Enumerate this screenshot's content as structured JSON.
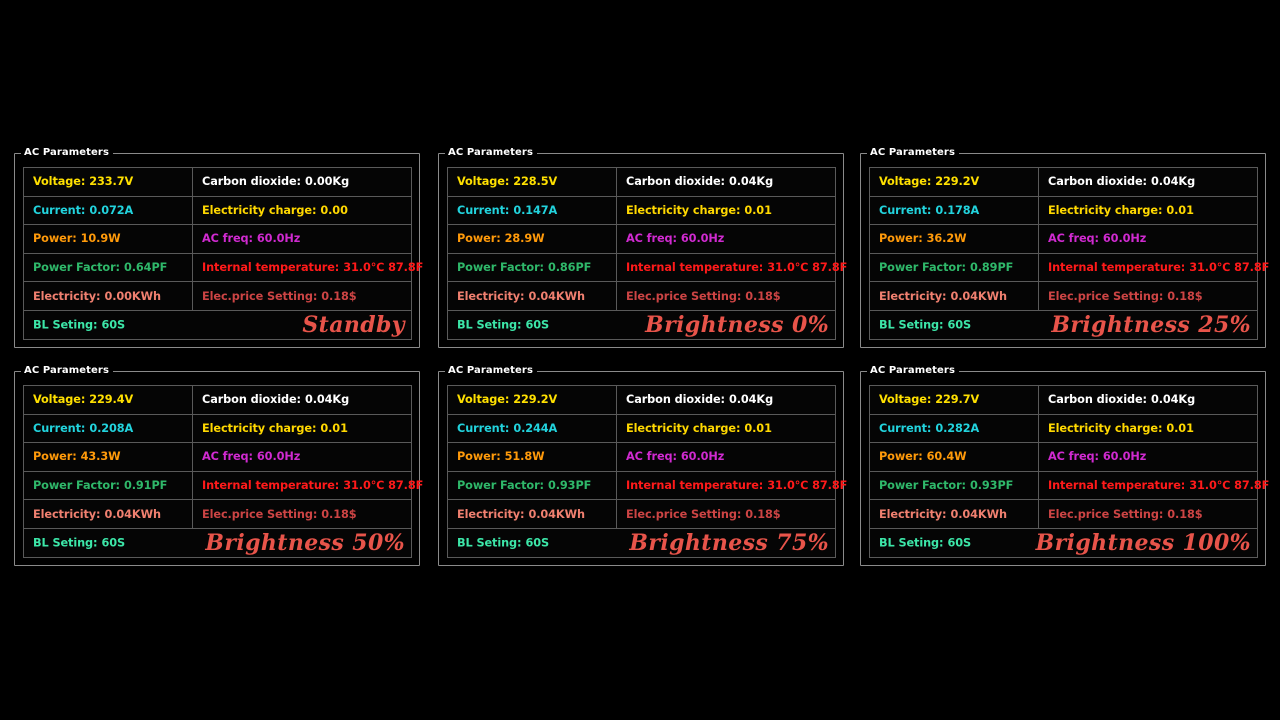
{
  "group_title": "AC Parameters",
  "labels": {
    "voltage": "Voltage:",
    "current": "Current:",
    "power": "Power:",
    "power_factor": "Power Factor:",
    "electricity": "Electricity:",
    "bl_seting": "BL Seting:",
    "carbon_dioxide": "Carbon dioxide:",
    "electricity_charge": "Electricity charge:",
    "ac_freq": "AC freq:",
    "internal_temperature": "Internal temperature:",
    "elec_price_setting": "Elec.price Setting:"
  },
  "colors": {
    "background": "#000000",
    "panel_border": "#8a8a8a",
    "table_border": "#5a5a5a",
    "voltage": "#ffe000",
    "current": "#22d3dd",
    "power": "#ff9a0a",
    "power_factor": "#2fb86a",
    "electricity": "#f08070",
    "bl_seting": "#3ce6a8",
    "carbon_dioxide": "#ffffff",
    "electricity_charge": "#ffd800",
    "ac_freq": "#d02ad0",
    "internal_temperature": "#ff1a1a",
    "elec_price_setting": "#cc4444",
    "status": "#e8544a"
  },
  "panels": [
    {
      "voltage": "233.7V",
      "current": "0.072A",
      "power": "10.9W",
      "power_factor": "0.64PF",
      "electricity": "0.00KWh",
      "bl_seting": "60S",
      "carbon_dioxide": "0.00Kg",
      "electricity_charge": "0.00",
      "ac_freq": "60.0Hz",
      "internal_temperature": "31.0℃ 87.8F",
      "elec_price_setting": "0.18$",
      "status": "Standby"
    },
    {
      "voltage": "228.5V",
      "current": "0.147A",
      "power": "28.9W",
      "power_factor": "0.86PF",
      "electricity": "0.04KWh",
      "bl_seting": "60S",
      "carbon_dioxide": "0.04Kg",
      "electricity_charge": "0.01",
      "ac_freq": "60.0Hz",
      "internal_temperature": "31.0℃ 87.8F",
      "elec_price_setting": "0.18$",
      "status": "Brightness 0%"
    },
    {
      "voltage": "229.2V",
      "current": "0.178A",
      "power": "36.2W",
      "power_factor": "0.89PF",
      "electricity": "0.04KWh",
      "bl_seting": "60S",
      "carbon_dioxide": "0.04Kg",
      "electricity_charge": "0.01",
      "ac_freq": "60.0Hz",
      "internal_temperature": "31.0℃ 87.8F",
      "elec_price_setting": "0.18$",
      "status": "Brightness 25%"
    },
    {
      "voltage": "229.4V",
      "current": "0.208A",
      "power": "43.3W",
      "power_factor": "0.91PF",
      "electricity": "0.04KWh",
      "bl_seting": "60S",
      "carbon_dioxide": "0.04Kg",
      "electricity_charge": "0.01",
      "ac_freq": "60.0Hz",
      "internal_temperature": "31.0℃ 87.8F",
      "elec_price_setting": "0.18$",
      "status": "Brightness 50%"
    },
    {
      "voltage": "229.2V",
      "current": "0.244A",
      "power": "51.8W",
      "power_factor": "0.93PF",
      "electricity": "0.04KWh",
      "bl_seting": "60S",
      "carbon_dioxide": "0.04Kg",
      "electricity_charge": "0.01",
      "ac_freq": "60.0Hz",
      "internal_temperature": "31.0℃ 87.8F",
      "elec_price_setting": "0.18$",
      "status": "Brightness 75%"
    },
    {
      "voltage": "229.7V",
      "current": "0.282A",
      "power": "60.4W",
      "power_factor": "0.93PF",
      "electricity": "0.04KWh",
      "bl_seting": "60S",
      "carbon_dioxide": "0.04Kg",
      "electricity_charge": "0.01",
      "ac_freq": "60.0Hz",
      "internal_temperature": "31.0℃ 87.8F",
      "elec_price_setting": "0.18$",
      "status": "Brightness 100%"
    }
  ]
}
